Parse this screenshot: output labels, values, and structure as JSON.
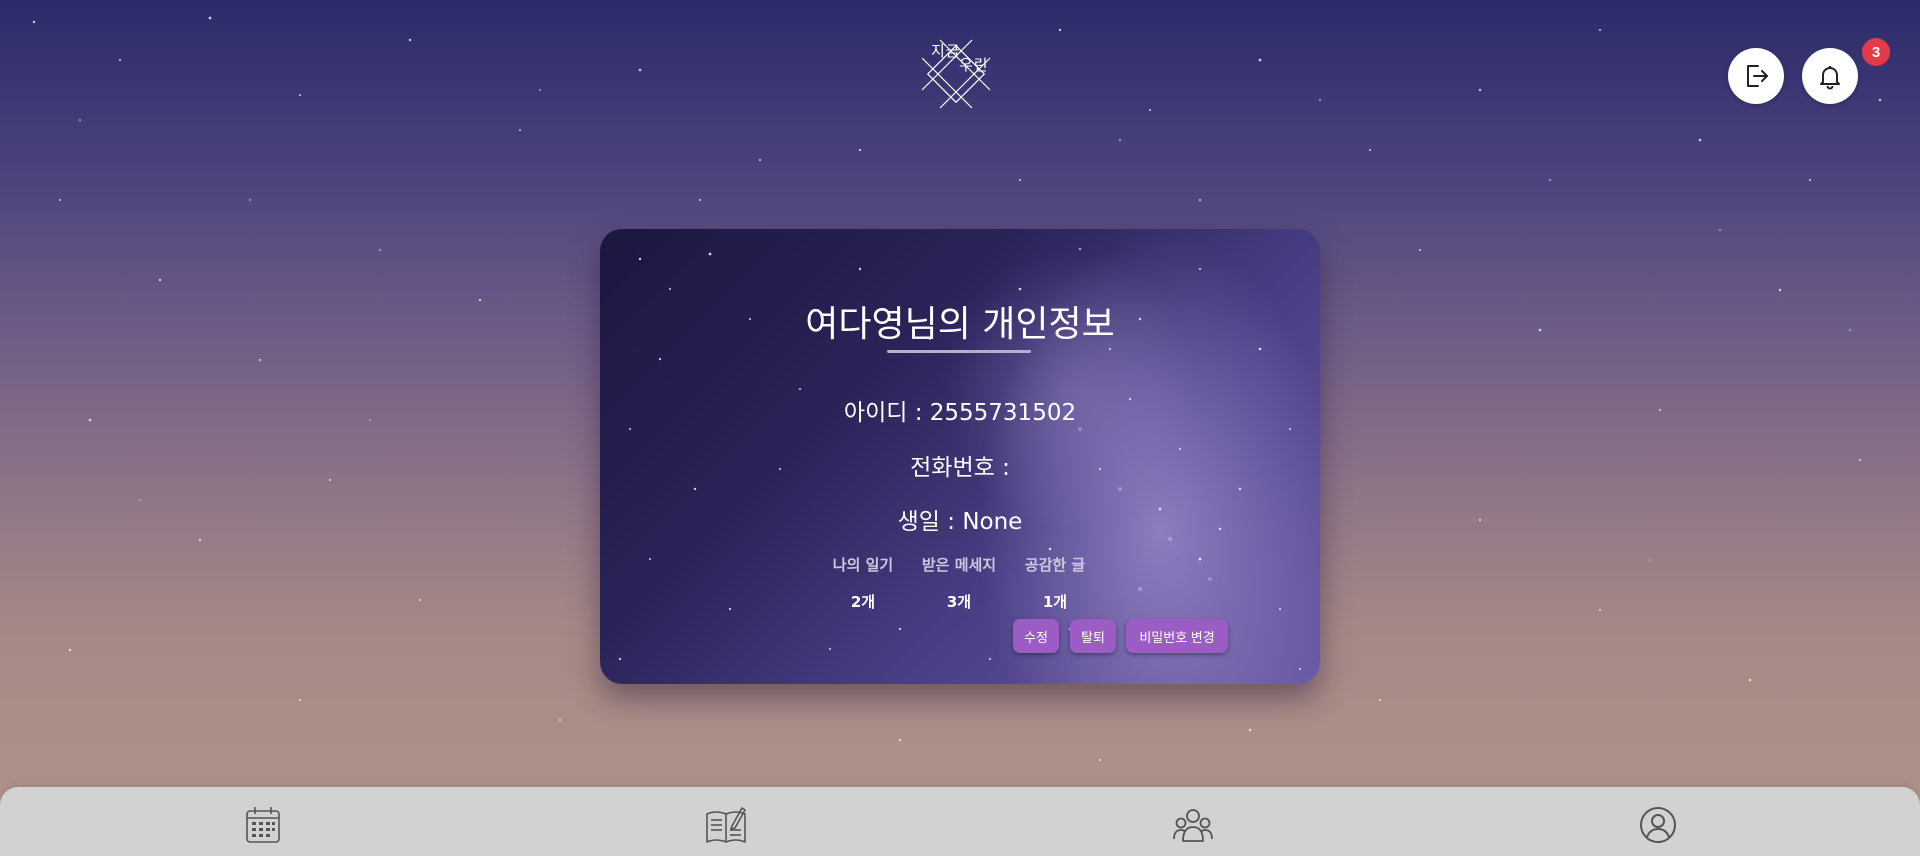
{
  "app": {
    "logo_text_line1": "지금",
    "logo_text_line2": "우린"
  },
  "header": {
    "logout_icon": "logout-icon",
    "bell_icon": "bell-icon",
    "notification_count": "3"
  },
  "profile": {
    "title": "여다영님의 개인정보",
    "id_line": "아이디 : 2555731502",
    "phone_line": "전화번호 :",
    "birthday_line": "생일 : None",
    "stats": [
      {
        "label": "나의 일기",
        "value": "2개"
      },
      {
        "label": "받은 메세지",
        "value": "3개"
      },
      {
        "label": "공감한 글",
        "value": "1개"
      }
    ],
    "buttons": {
      "edit": "수정",
      "withdraw": "탈퇴",
      "change_password": "비밀번호 변경"
    }
  },
  "bottom_nav": [
    {
      "icon": "calendar-icon"
    },
    {
      "icon": "diary-icon"
    },
    {
      "icon": "community-icon"
    },
    {
      "icon": "profile-icon"
    }
  ],
  "colors": {
    "button": "#9b5cc4",
    "badge": "#e23b4a",
    "nav_bg": "#d3d2d2"
  }
}
